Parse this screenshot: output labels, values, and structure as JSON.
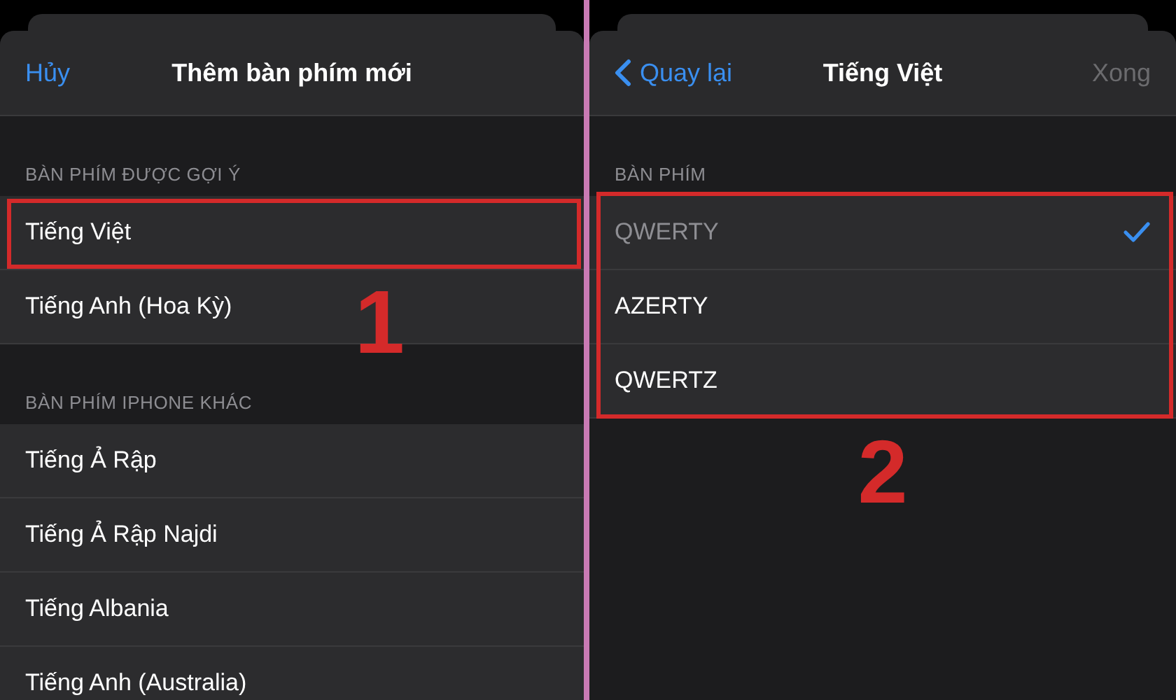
{
  "panels": [
    {
      "nav": {
        "back": "Hủy",
        "back_chevron": false,
        "title": "Thêm bàn phím mới"
      },
      "sections": [
        {
          "header": "BÀN PHÍM ĐƯỢC GỢI Ý",
          "kind": "first-framed",
          "annotation": "1",
          "rows": [
            {
              "label": "Tiếng Việt",
              "selected": false,
              "disabled": false
            },
            {
              "label": "Tiếng Anh (Hoa Kỳ)",
              "selected": false,
              "disabled": false
            }
          ]
        },
        {
          "header": "BÀN PHÍM IPHONE KHÁC",
          "kind": "plain",
          "rows": [
            {
              "label": "Tiếng Ả Rập",
              "selected": false,
              "disabled": false
            },
            {
              "label": "Tiếng Ả Rập Najdi",
              "selected": false,
              "disabled": false
            },
            {
              "label": "Tiếng Albania",
              "selected": false,
              "disabled": false
            },
            {
              "label": "Tiếng Anh (Australia)",
              "selected": false,
              "disabled": false
            }
          ]
        }
      ]
    },
    {
      "nav": {
        "back": "Quay lại",
        "back_chevron": true,
        "title": "Tiếng Việt",
        "done": "Xong"
      },
      "sections": [
        {
          "header": "BÀN PHÍM",
          "kind": "framed",
          "annotation": "2",
          "rows": [
            {
              "label": "QWERTY",
              "selected": true,
              "disabled": true
            },
            {
              "label": "AZERTY",
              "selected": false,
              "disabled": false
            },
            {
              "label": "QWERTZ",
              "selected": false,
              "disabled": false
            }
          ]
        }
      ]
    }
  ]
}
